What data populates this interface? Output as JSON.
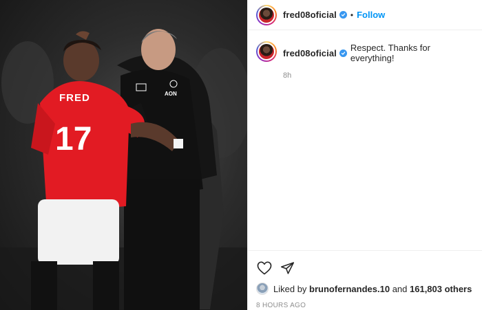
{
  "post": {
    "username": "fred08oficial",
    "follow_label": "Follow",
    "separator": "•",
    "caption": "Respect. Thanks for everything!",
    "caption_age": "8h",
    "liked_prefix": "Liked by ",
    "liked_by": "brunofernandes.10",
    "liked_and": " and ",
    "likes_count": "161,803 others",
    "date": "8 HOURS AGO"
  },
  "photo": {
    "jersey_name": "FRED",
    "jersey_number": "17",
    "badge_text": "AON"
  },
  "icons": {
    "verified": "verified-badge-icon",
    "like": "heart-icon",
    "share": "paper-plane-icon"
  },
  "colors": {
    "accent": "#0095f6",
    "verified": "#3897f0",
    "jersey_red": "#e21b23",
    "muted_text": "#8e8e8e"
  }
}
